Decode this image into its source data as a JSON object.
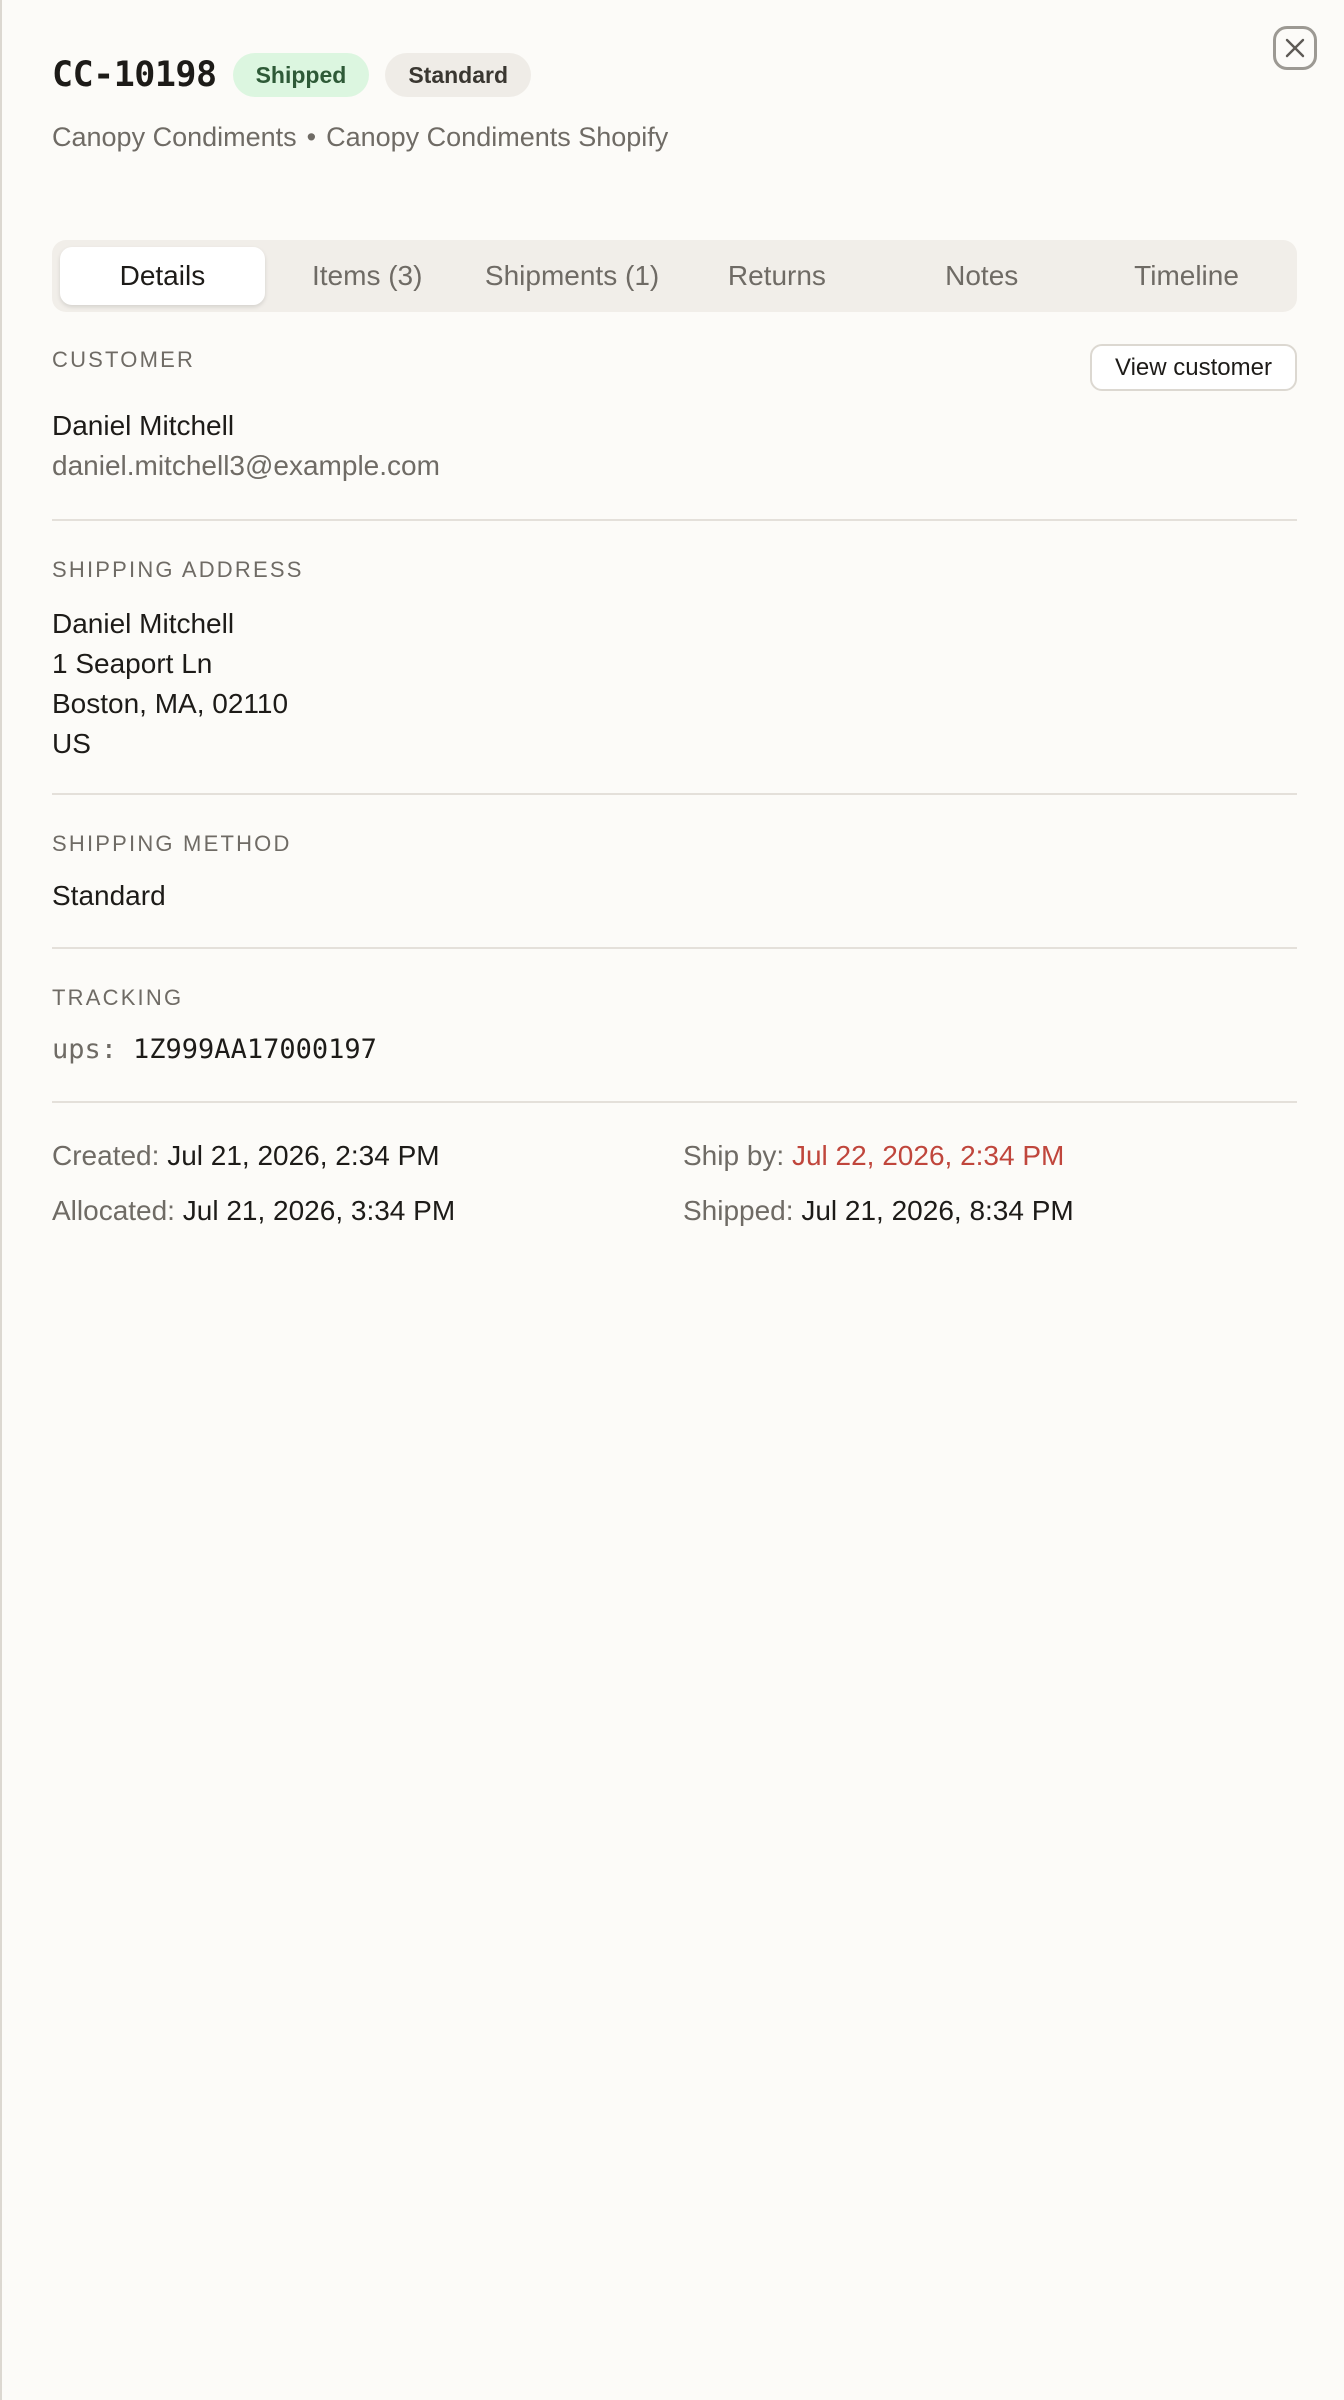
{
  "header": {
    "order_id": "CC-10198",
    "status_badge": "Shipped",
    "service_badge": "Standard",
    "brand": "Canopy Condiments",
    "separator": "•",
    "store": "Canopy Condiments Shopify"
  },
  "close_icon": "close-icon",
  "tabs": [
    {
      "label": "Details",
      "active": true
    },
    {
      "label": "Items (3)",
      "active": false
    },
    {
      "label": "Shipments (1)",
      "active": false
    },
    {
      "label": "Returns",
      "active": false
    },
    {
      "label": "Notes",
      "active": false
    },
    {
      "label": "Timeline",
      "active": false
    }
  ],
  "customer": {
    "label": "Customer",
    "view_button": "View customer",
    "name": "Daniel Mitchell",
    "email": "daniel.mitchell3@example.com"
  },
  "shipping_address": {
    "label": "Shipping Address",
    "lines": [
      "Daniel Mitchell",
      "1 Seaport Ln",
      "Boston, MA, 02110",
      "US"
    ]
  },
  "shipping_method": {
    "label": "Shipping Method",
    "value": "Standard"
  },
  "tracking": {
    "label": "Tracking",
    "carrier": "ups:",
    "number": "1Z999AA17000197"
  },
  "dates": {
    "created_label": "Created:",
    "created_value": "Jul 21, 2026, 2:34 PM",
    "ship_by_label": "Ship by:",
    "ship_by_value": "Jul 22, 2026, 2:34 PM",
    "allocated_label": "Allocated:",
    "allocated_value": "Jul 21, 2026, 3:34 PM",
    "shipped_label": "Shipped:",
    "shipped_value": "Jul 21, 2026, 8:34 PM"
  },
  "colors": {
    "background": "#fcfbf8",
    "shipped_badge_bg": "#dcf6e0",
    "ship_by_late": "#c0463c"
  }
}
